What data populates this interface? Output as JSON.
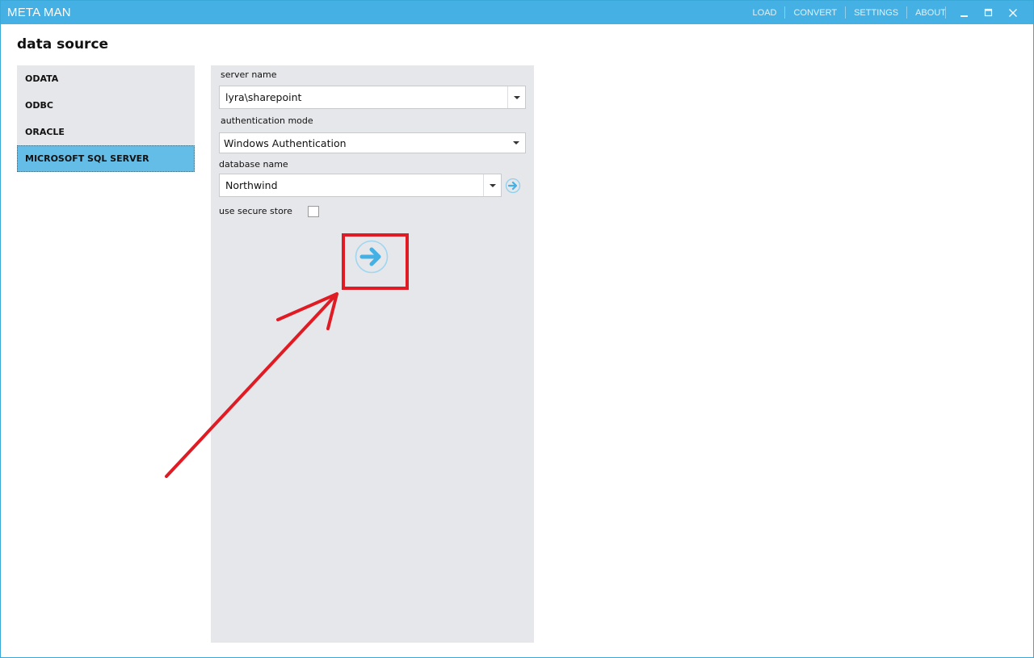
{
  "app": {
    "title": "META MAN"
  },
  "menu": {
    "load": "LOAD",
    "convert": "CONVERT",
    "settings": "SETTINGS",
    "about": "ABOUT"
  },
  "page": {
    "title": "data source"
  },
  "sources": {
    "items": [
      {
        "label": "ODATA"
      },
      {
        "label": "ODBC"
      },
      {
        "label": "ORACLE"
      },
      {
        "label": "MICROSOFT SQL SERVER"
      }
    ],
    "selected": "MICROSOFT SQL SERVER"
  },
  "form": {
    "server_name_label": "server name",
    "server_name_value": "lyra\\sharepoint",
    "auth_mode_label": "authentication mode",
    "auth_mode_value": "Windows Authentication",
    "database_name_label": "database name",
    "database_name_value": "Northwind",
    "secure_store_label": "use secure store",
    "secure_store_checked": false
  },
  "icons": {
    "titlebar": [
      "minimize-icon",
      "maximize-icon",
      "close-icon"
    ],
    "go": "arrow-right-circle-icon",
    "dropdown": "chevron-down-icon"
  },
  "colors": {
    "titlebar": "#45b0e3",
    "selected_item": "#64bde6",
    "panel": "#e6e7ea",
    "annotation": "#e01b24"
  }
}
